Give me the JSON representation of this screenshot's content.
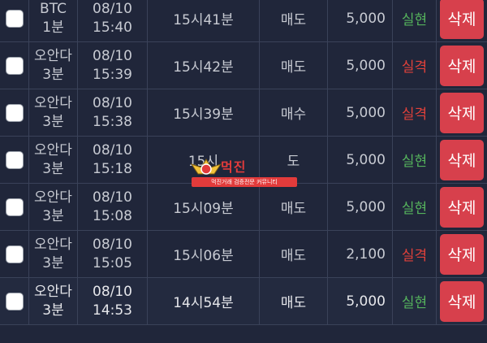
{
  "rows": [
    {
      "symbol_1": "BTC",
      "symbol_2": "1분",
      "date": "08/10",
      "time": "15:40",
      "target": "15시41분",
      "direction": "매도",
      "amount": "5,000",
      "result": "실현",
      "result_type": "real",
      "delete_label": "삭제"
    },
    {
      "symbol_1": "오안다",
      "symbol_2": "3분",
      "date": "08/10",
      "time": "15:39",
      "target": "15시42분",
      "direction": "매도",
      "amount": "5,000",
      "result": "실격",
      "result_type": "fail",
      "delete_label": "삭제"
    },
    {
      "symbol_1": "오안다",
      "symbol_2": "3분",
      "date": "08/10",
      "time": "15:38",
      "target": "15시39분",
      "direction": "매수",
      "amount": "5,000",
      "result": "실격",
      "result_type": "fail",
      "delete_label": "삭제"
    },
    {
      "symbol_1": "오안다",
      "symbol_2": "3분",
      "date": "08/10",
      "time": "15:18",
      "target": "15시",
      "direction": "도",
      "amount": "5,000",
      "result": "실현",
      "result_type": "real",
      "delete_label": "삭제"
    },
    {
      "symbol_1": "오안다",
      "symbol_2": "3분",
      "date": "08/10",
      "time": "15:08",
      "target": "15시09분",
      "direction": "매도",
      "amount": "5,000",
      "result": "실현",
      "result_type": "real",
      "delete_label": "삭제"
    },
    {
      "symbol_1": "오안다",
      "symbol_2": "3분",
      "date": "08/10",
      "time": "15:05",
      "target": "15시06분",
      "direction": "매도",
      "amount": "2,100",
      "result": "실격",
      "result_type": "fail",
      "delete_label": "삭제"
    },
    {
      "symbol_1": "오안다",
      "symbol_2": "3분",
      "date": "08/10",
      "time": "14:53",
      "target": "14시54분",
      "direction": "매도",
      "amount": "5,000",
      "result": "실현",
      "result_type": "real",
      "delete_label": "삭제"
    }
  ],
  "watermark": {
    "title": "먹진",
    "subtitle": "먹진거래 검증전문 커뮤니티"
  },
  "colors": {
    "background": "#20263a",
    "real": "#55b35c",
    "fail": "#e0413a",
    "delete": "#d7404c"
  }
}
